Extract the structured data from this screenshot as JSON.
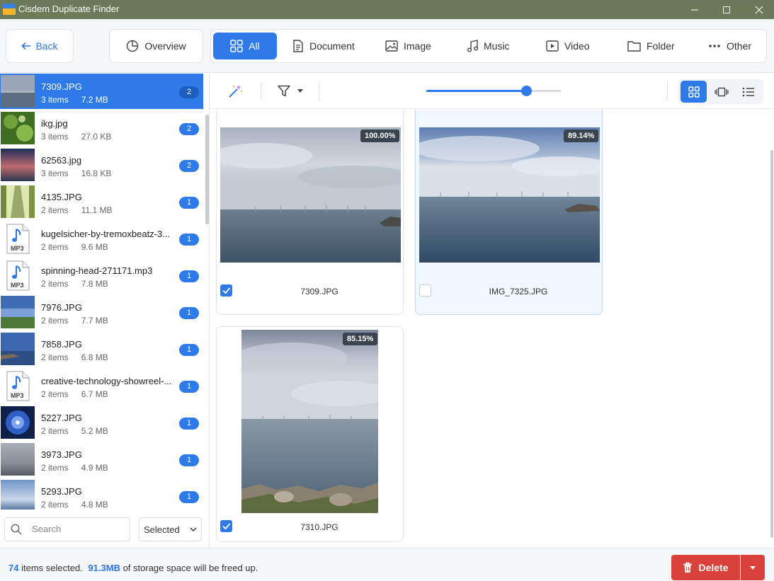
{
  "window": {
    "title": "Cisdem Duplicate Finder"
  },
  "toolbar": {
    "back_label": "Back",
    "overview_label": "Overview",
    "categories": [
      {
        "label": "All",
        "icon": "grid-icon",
        "active": true
      },
      {
        "label": "Document",
        "icon": "document-icon",
        "active": false
      },
      {
        "label": "Image",
        "icon": "image-icon",
        "active": false
      },
      {
        "label": "Music",
        "icon": "music-note-icon",
        "active": false
      },
      {
        "label": "Video",
        "icon": "video-icon",
        "active": false
      },
      {
        "label": "Folder",
        "icon": "folder-icon",
        "active": false
      },
      {
        "label": "Other",
        "icon": "more-dots-icon",
        "active": false
      }
    ]
  },
  "sidebar": {
    "items": [
      {
        "name": "7309.JPG",
        "count": "3 items",
        "size": "7.2 MB",
        "badge": "2",
        "thumb": "sea-overcast",
        "selected": true
      },
      {
        "name": "ikg.jpg",
        "count": "3 items",
        "size": "27.0 KB",
        "badge": "2",
        "thumb": "green-leaves",
        "selected": false
      },
      {
        "name": "62563.jpg",
        "count": "3 items",
        "size": "16.8 KB",
        "badge": "2",
        "thumb": "sunset-sky",
        "selected": false
      },
      {
        "name": "4135.JPG",
        "count": "2 items",
        "size": "11.1 MB",
        "badge": "1",
        "thumb": "field-path",
        "selected": false
      },
      {
        "name": "kugelsicher-by-tremoxbeatz-3...",
        "count": "2 items",
        "size": "9.6 MB",
        "badge": "1",
        "thumb": "mp3-file",
        "selected": false
      },
      {
        "name": "spinning-head-271171.mp3",
        "count": "2 items",
        "size": "7.8 MB",
        "badge": "1",
        "thumb": "mp3-file",
        "selected": false
      },
      {
        "name": "7976.JPG",
        "count": "2 items",
        "size": "7.7 MB",
        "badge": "1",
        "thumb": "blue-sky-grass",
        "selected": false
      },
      {
        "name": "7858.JPG",
        "count": "2 items",
        "size": "6.8 MB",
        "badge": "1",
        "thumb": "blue-sea",
        "selected": false
      },
      {
        "name": "creative-technology-showreel-...",
        "count": "2 items",
        "size": "6.7 MB",
        "badge": "1",
        "thumb": "mp3-file",
        "selected": false
      },
      {
        "name": "5227.JPG",
        "count": "2 items",
        "size": "5.2 MB",
        "badge": "1",
        "thumb": "blue-flower",
        "selected": false
      },
      {
        "name": "3973.JPG",
        "count": "2 items",
        "size": "4.9 MB",
        "badge": "1",
        "thumb": "dusk-horizon",
        "selected": false
      },
      {
        "name": "5293.JPG",
        "count": "2 items",
        "size": "4.8 MB",
        "badge": "1",
        "thumb": "bright-sky",
        "selected": false
      }
    ],
    "mp3_label": "MP3",
    "search_placeholder": "Search",
    "filter_value": "Selected"
  },
  "view": {
    "zoom_fraction": 0.74
  },
  "cards": [
    {
      "percent": "100.00%",
      "filename": "7309.JPG",
      "checked": true
    },
    {
      "percent": "89.14%",
      "filename": "IMG_7325.JPG",
      "checked": false
    },
    {
      "percent": "85.15%",
      "filename": "7310.JPG",
      "checked": true
    }
  ],
  "status": {
    "count": "74",
    "count_suffix": "items selected.",
    "size": "91.3MB",
    "size_suffix": "of storage space will be freed up.",
    "delete_label": "Delete"
  },
  "colors": {
    "accent": "#2d7ae8",
    "titlebar": "#6b7a58",
    "delete": "#d9413a"
  }
}
